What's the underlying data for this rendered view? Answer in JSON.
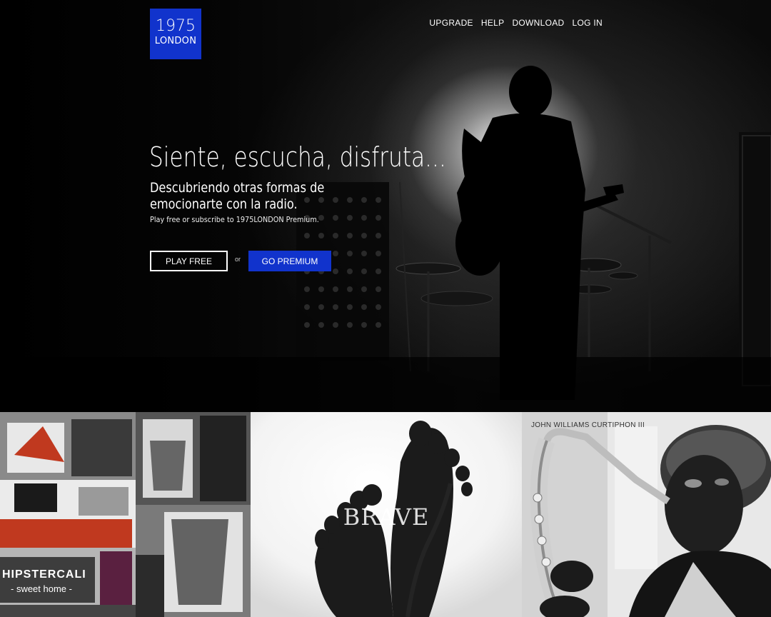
{
  "brand": {
    "line1": "1975",
    "line2": "LONDON",
    "color": "#1133cc"
  },
  "nav": [
    {
      "label": "UPGRADE"
    },
    {
      "label": "HELP"
    },
    {
      "label": "DOWNLOAD"
    },
    {
      "label": "LOG IN"
    }
  ],
  "hero": {
    "headline": "Siente, escucha, disfruta...",
    "subhead": "Descubriendo otras formas de emocionarte con la radio.",
    "tagline": "Play free or subscribe to 1975LONDON Premium.",
    "play_free_label": "PLAY FREE",
    "or_label": "or",
    "go_premium_label": "GO PREMIUM"
  },
  "tiles": [
    {
      "title": "HIPSTERCALI",
      "subtitle": "- sweet home -"
    },
    {
      "title": "BRAVE"
    },
    {
      "title": "JOHN WILLIAMS CURTIPHON III"
    }
  ]
}
